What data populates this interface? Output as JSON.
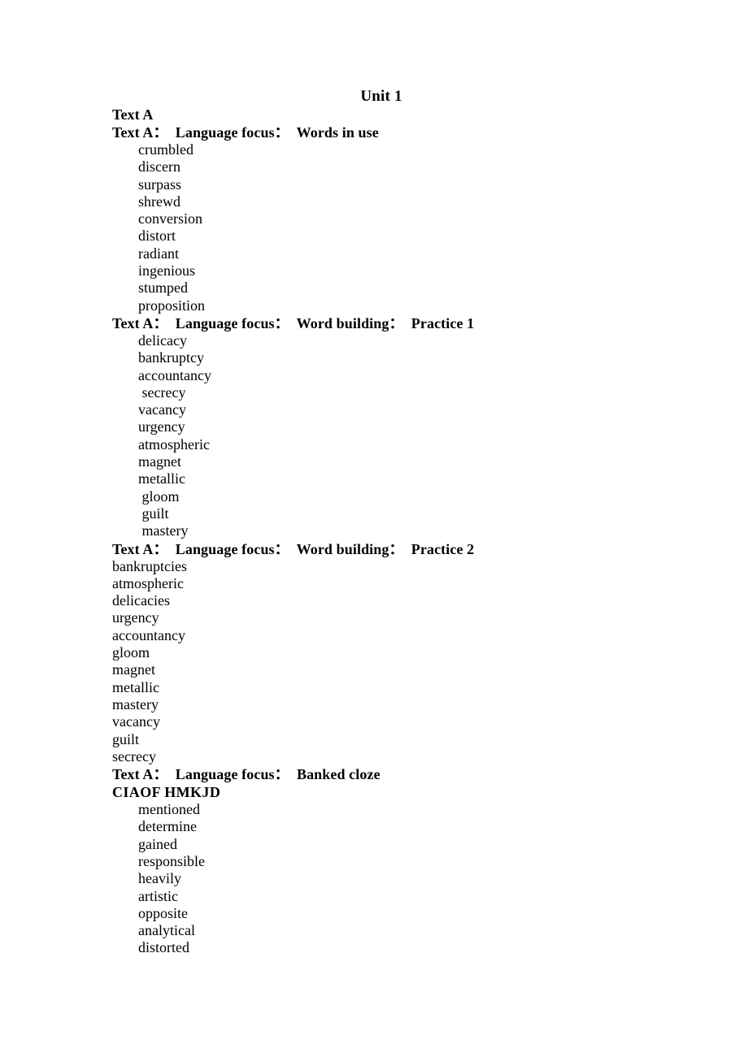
{
  "document": {
    "title": "Unit 1",
    "sections": [
      {
        "heading": "Text A",
        "indent_style": "none",
        "words": []
      },
      {
        "heading": "Text A：  Language focus：  Words in use",
        "indent_style": "indented",
        "words": [
          "crumbled",
          "discern",
          "surpass",
          "shrewd",
          "conversion",
          "distort",
          "radiant",
          "ingenious",
          "stumped",
          "proposition"
        ]
      },
      {
        "heading": "Text A：  Language focus：  Word building：  Practice 1",
        "indent_style": "indented",
        "words": [
          "delicacy",
          "bankruptcy",
          "accountancy",
          " secrecy",
          "vacancy",
          "urgency",
          "atmospheric",
          "magnet",
          "metallic",
          " gloom",
          " guilt",
          " mastery"
        ]
      },
      {
        "heading": "Text A：  Language focus：  Word building：  Practice 2",
        "indent_style": "flush",
        "words": [
          "bankruptcies",
          "atmospheric",
          "delicacies",
          "urgency",
          "accountancy",
          "gloom",
          "magnet",
          "metallic",
          "mastery",
          "vacancy",
          "guilt",
          "secrecy"
        ]
      },
      {
        "heading": "Text A：  Language focus：  Banked cloze",
        "answer_key": "CIAOF HMKJD",
        "indent_style": "indented",
        "words": [
          "mentioned",
          "determine",
          "gained",
          "responsible",
          "heavily",
          "artistic",
          "opposite",
          "analytical",
          "distorted"
        ]
      }
    ]
  }
}
